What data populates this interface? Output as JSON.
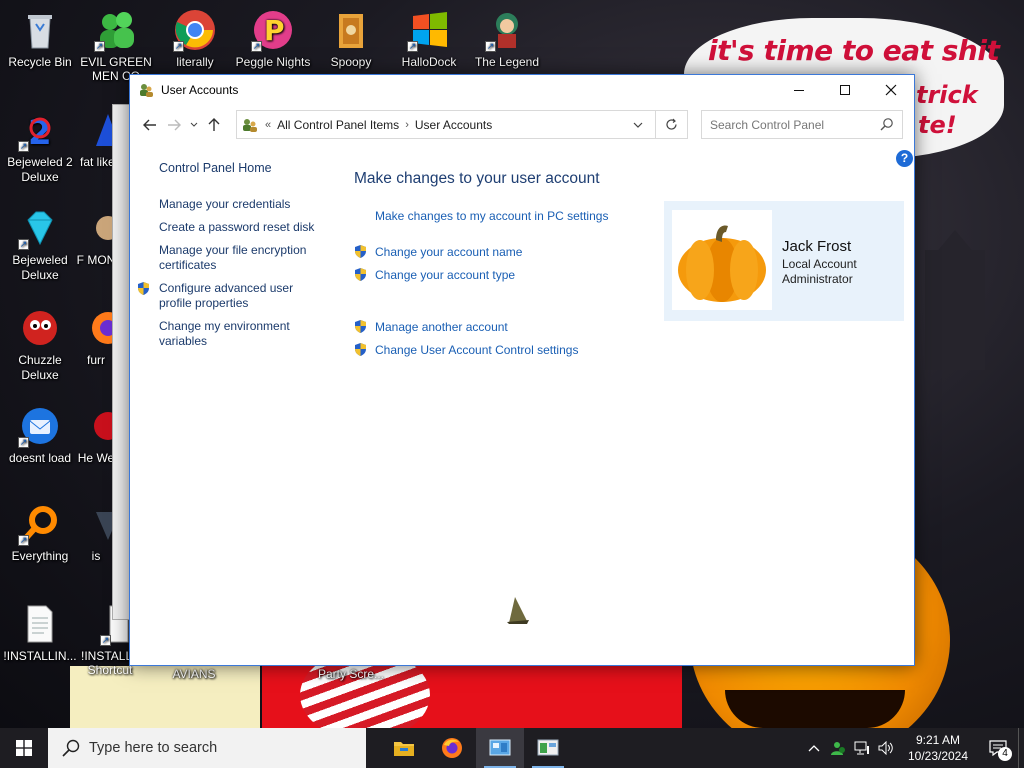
{
  "desktop": {
    "wallpaper_text": [
      "it's time to eat shit",
      "trick",
      "te!"
    ],
    "icons": [
      {
        "label": "Recycle Bin",
        "icon": "recycle-bin-icon"
      },
      {
        "label": "EVIL GREEN MEN CO",
        "icon": "green-men-icon"
      },
      {
        "label": "literally",
        "icon": "chrome-icon"
      },
      {
        "label": "Peggle Nights",
        "icon": "peggle-icon"
      },
      {
        "label": "Spoopy",
        "icon": "folder-icon"
      },
      {
        "label": "HalloDock",
        "icon": "windows-logo-icon"
      },
      {
        "label": "The Legend",
        "icon": "game-character-icon"
      },
      {
        "label": "Bejeweled 2 Deluxe",
        "icon": "bejeweled2-icon"
      },
      {
        "label": "fat like",
        "icon": "app-icon"
      },
      {
        "label": "Bejeweled Deluxe",
        "icon": "diamond-icon"
      },
      {
        "label": "F MON",
        "icon": "app-icon"
      },
      {
        "label": "Chuzzle Deluxe",
        "icon": "chuzzle-icon"
      },
      {
        "label": "furr",
        "icon": "firefox-icon"
      },
      {
        "label": "doesnt load",
        "icon": "thunderbird-icon"
      },
      {
        "label": "He We",
        "icon": "app-icon"
      },
      {
        "label": "Everything",
        "icon": "everything-search-icon"
      },
      {
        "label": "is",
        "icon": "app-icon"
      },
      {
        "label": "!INSTALLIN...",
        "icon": "text-file-icon"
      },
      {
        "label": "!INSTALL - Shortcut",
        "icon": "text-file-icon"
      },
      {
        "label": "AVIANS",
        "icon": "app-icon"
      },
      {
        "label": "Party Scre...",
        "icon": "app-icon"
      }
    ]
  },
  "window": {
    "title": "User Accounts",
    "address": {
      "overflow": "«",
      "crumbs": [
        "All Control Panel Items",
        "User Accounts"
      ]
    },
    "search_placeholder": "Search Control Panel",
    "help": "?",
    "left_nav": {
      "home": "Control Panel Home",
      "links": [
        "Manage your credentials",
        "Create a password reset disk",
        "Manage your file encryption certificates",
        "Configure advanced user profile properties",
        "Change my environment variables"
      ]
    },
    "main": {
      "heading": "Make changes to your user account",
      "pc_settings_link": "Make changes to my account in PC settings",
      "tasks_group1": [
        "Change your account name",
        "Change your account type"
      ],
      "tasks_group2": [
        "Manage another account",
        "Change User Account Control settings"
      ]
    },
    "user": {
      "name": "Jack Frost",
      "type": "Local Account",
      "role": "Administrator"
    }
  },
  "taskbar": {
    "search_placeholder": "Type here to search",
    "apps": [
      "file-explorer-icon",
      "firefox-icon",
      "control-panel-icon",
      "control-panel-2-icon"
    ],
    "clock_time": "9:21 AM",
    "clock_date": "10/23/2024",
    "notification_count": "4"
  }
}
